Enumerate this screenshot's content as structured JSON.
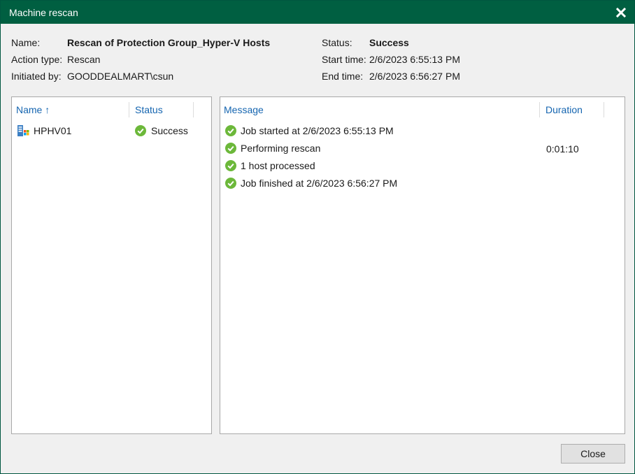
{
  "window": {
    "title": "Machine rescan"
  },
  "details": {
    "name_label": "Name:",
    "name_value": "Rescan of Protection Group_Hyper-V Hosts",
    "action_label": "Action type:",
    "action_value": "Rescan",
    "initiated_label": "Initiated by:",
    "initiated_value": "GOODDEALMART\\csun",
    "status_label": "Status:",
    "status_value": "Success",
    "start_label": "Start time:",
    "start_value": "2/6/2023 6:55:13 PM",
    "end_label": "End time:",
    "end_value": "2/6/2023 6:56:27 PM"
  },
  "hosts_table": {
    "columns": {
      "name": "Name",
      "sort_arrow": "↑",
      "status": "Status"
    },
    "rows": [
      {
        "name": "HPHV01",
        "status": "Success",
        "icon": "hyperv-host-icon"
      }
    ]
  },
  "log_table": {
    "columns": {
      "message": "Message",
      "duration": "Duration"
    },
    "rows": [
      {
        "message": "Job started at 2/6/2023 6:55:13 PM",
        "duration": ""
      },
      {
        "message": "Performing rescan",
        "duration": "0:01:10"
      },
      {
        "message": "1 host processed",
        "duration": ""
      },
      {
        "message": "Job finished at 2/6/2023 6:56:27 PM",
        "duration": ""
      }
    ]
  },
  "footer": {
    "close_label": "Close"
  },
  "colors": {
    "titlebar": "#005f41",
    "success": "#6cb83a",
    "header_link": "#1565b0"
  }
}
